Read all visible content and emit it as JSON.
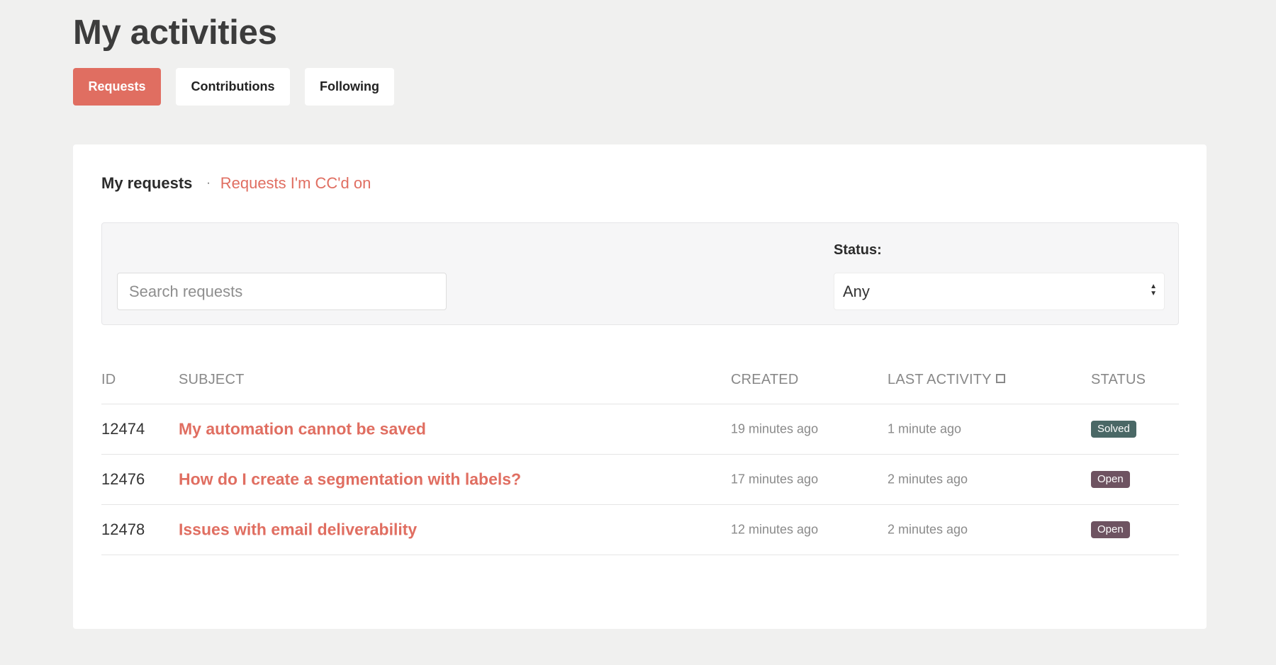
{
  "page": {
    "title": "My activities"
  },
  "tabs": [
    {
      "label": "Requests",
      "active": true
    },
    {
      "label": "Contributions",
      "active": false
    },
    {
      "label": "Following",
      "active": false
    }
  ],
  "subnav": {
    "current": "My requests",
    "separator": "·",
    "link": "Requests I'm CC'd on"
  },
  "filters": {
    "search_placeholder": "Search requests",
    "search_value": "",
    "status_label": "Status:",
    "status_selected": "Any",
    "select_arrow_up": "▲",
    "select_arrow_down": "▼",
    "select_icon": "sort-arrows-icon"
  },
  "table": {
    "headers": {
      "id": "ID",
      "subject": "SUBJECT",
      "created": "CREATED",
      "last_activity": "LAST ACTIVITY",
      "status": "STATUS"
    },
    "sort_icon": "sort-square-icon",
    "rows": [
      {
        "id": "12474",
        "subject": "My automation cannot be saved",
        "created": "19 minutes ago",
        "last_activity": "1 minute ago",
        "status": "Solved",
        "status_color": "#4a6866"
      },
      {
        "id": "12476",
        "subject": "How do I create a segmentation with labels?",
        "created": "17 minutes ago",
        "last_activity": "2 minutes ago",
        "status": "Open",
        "status_color": "#6e5361"
      },
      {
        "id": "12478",
        "subject": "Issues with email deliverability",
        "created": "12 minutes ago",
        "last_activity": "2 minutes ago",
        "status": "Open",
        "status_color": "#6e5361"
      }
    ]
  },
  "colors": {
    "accent": "#e06e61",
    "background": "#f0f0ef",
    "card": "#ffffff",
    "solved": "#4a6866",
    "open": "#6e5361"
  }
}
